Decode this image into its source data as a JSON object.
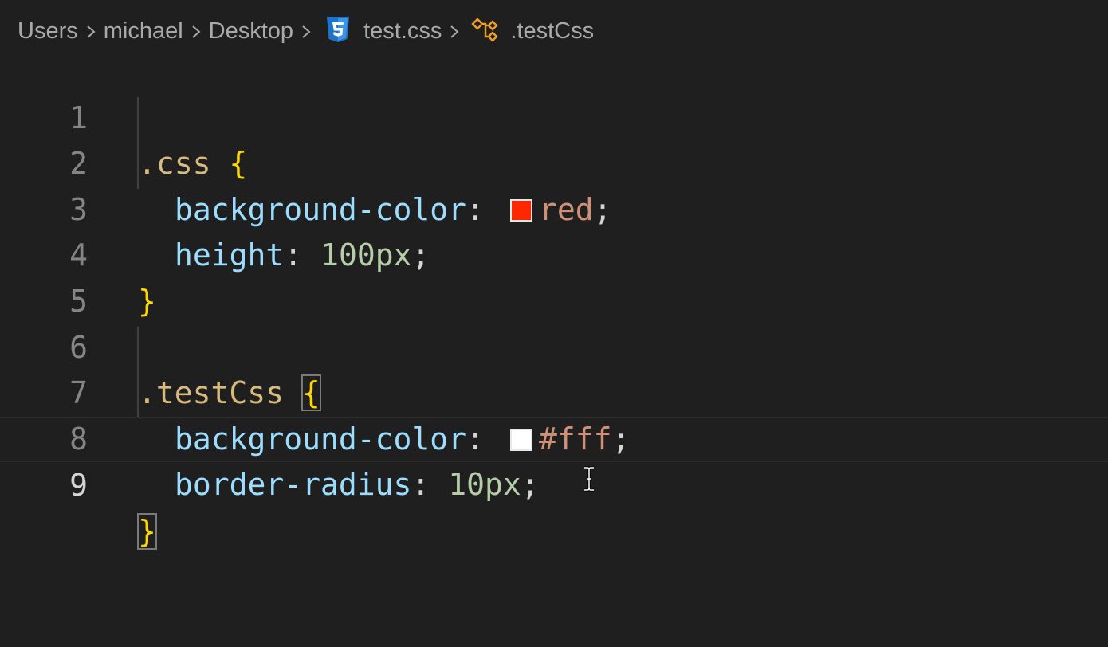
{
  "breadcrumb": {
    "items": [
      "Users",
      "michael",
      "Desktop",
      "test.css",
      ".testCss"
    ],
    "file_icon": "css3-file-icon",
    "symbol_icon": "symbol-class-icon"
  },
  "editor": {
    "current_line": 9,
    "line_numbers": [
      "1",
      "2",
      "3",
      "4",
      "5",
      "6",
      "7",
      "8",
      "9"
    ],
    "lines": {
      "l1": {
        "selector": ".css",
        "brace": "{"
      },
      "l2": {
        "property": "background-color",
        "colon": ":",
        "value": "red",
        "semicolon": ";",
        "swatch_color": "#ff2600"
      },
      "l3": {
        "property": "height",
        "colon": ":",
        "value": "100px",
        "semicolon": ";"
      },
      "l4": {
        "brace": "}"
      },
      "l6": {
        "selector": ".testCss",
        "brace": "{"
      },
      "l7": {
        "property": "background-color",
        "colon": ":",
        "value": "#fff",
        "semicolon": ";",
        "swatch_color": "#ffffff"
      },
      "l8": {
        "property": "border-radius",
        "colon": ":",
        "value": "10px",
        "semicolon": ";"
      },
      "l9": {
        "brace": "}"
      }
    }
  },
  "colors": {
    "background": "#1f1f1f",
    "selector": "#d7ba7d",
    "brace": "#ffd700",
    "property": "#9cdcfe",
    "string_value": "#ce9178",
    "number_value": "#b5cea8",
    "line_number": "#858585",
    "css_icon": "#1e73c8",
    "symbol_icon": "#ee9d28"
  },
  "mouse_cursor": "i-beam-cursor"
}
